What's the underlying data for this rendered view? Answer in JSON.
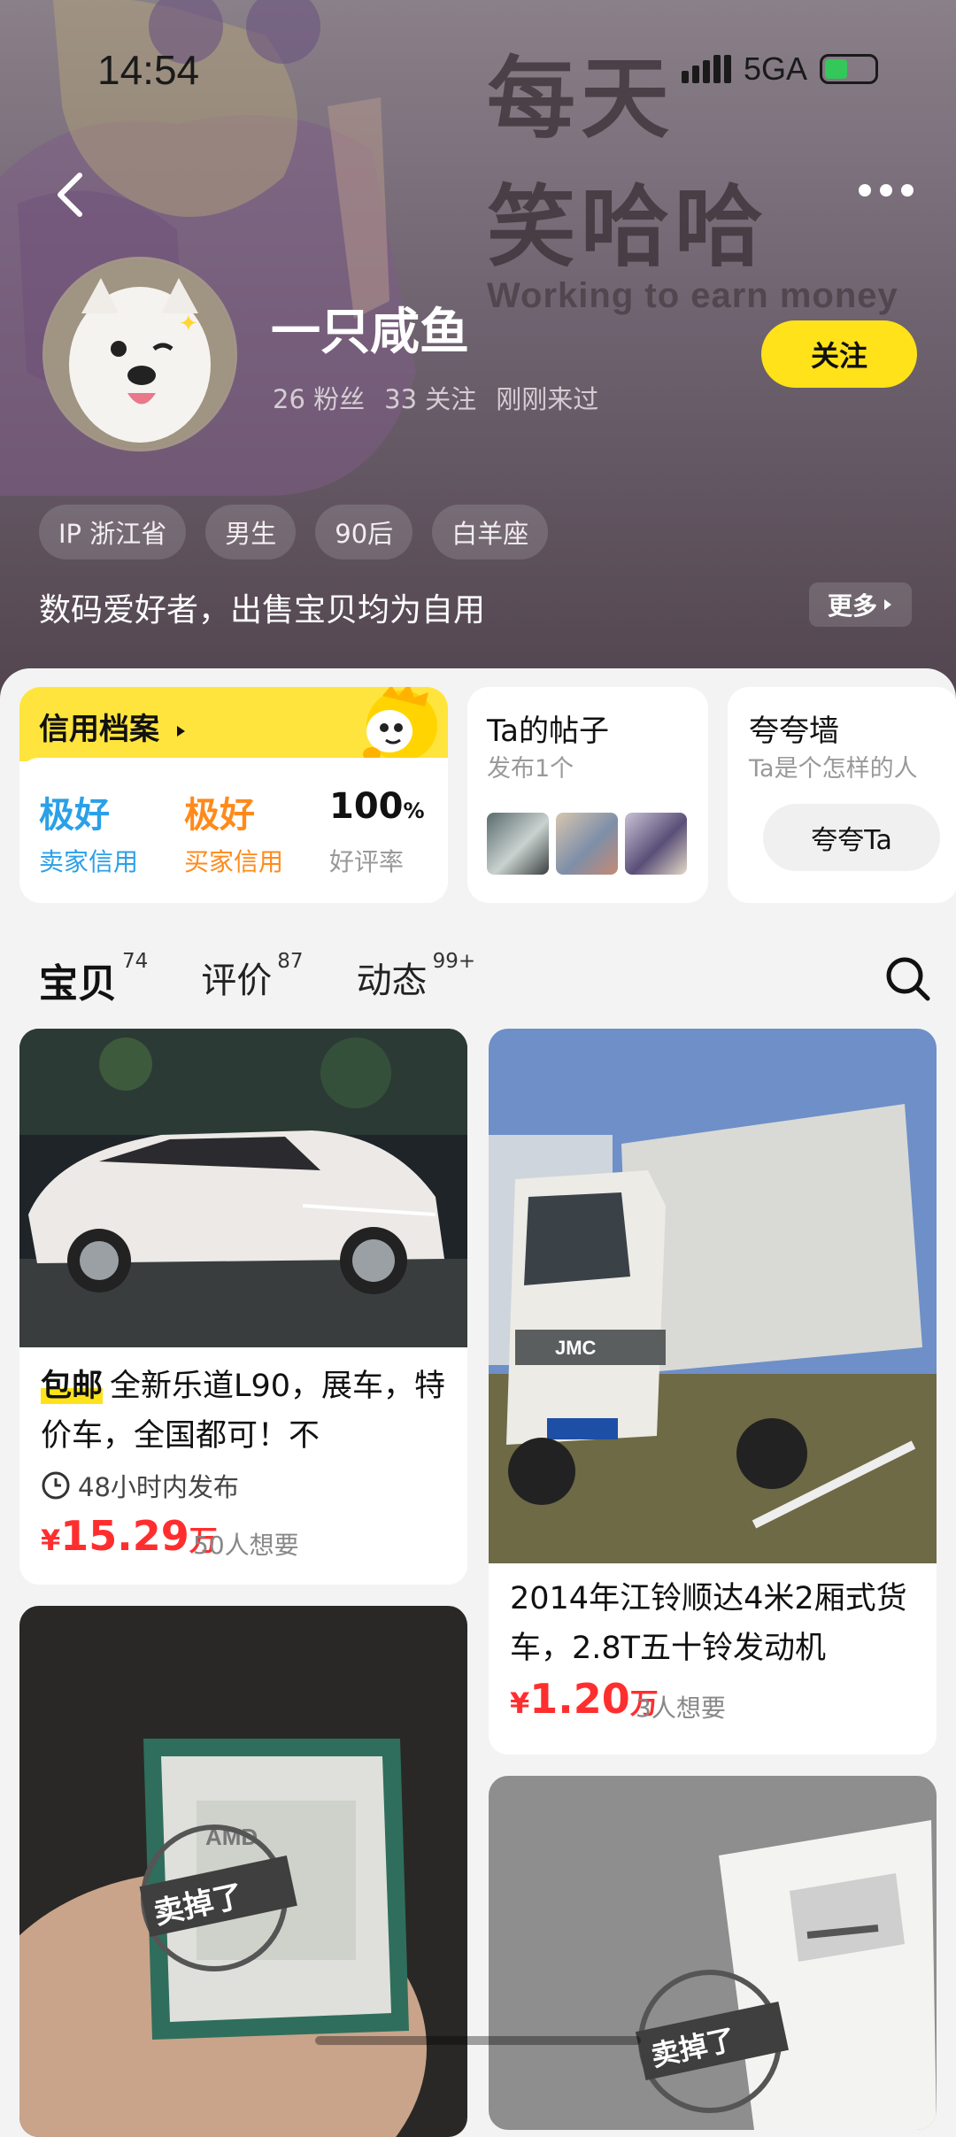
{
  "status": {
    "time": "14:54",
    "network": "5GA"
  },
  "banner": {
    "line1": "每天",
    "line2": "笑哈哈",
    "line3": "Working to earn money"
  },
  "profile": {
    "name": "一只咸鱼",
    "stats": [
      "26 粉丝",
      "33 关注",
      "刚刚来过"
    ],
    "follow_label": "关注",
    "tags": [
      "IP 浙江省",
      "男生",
      "90后",
      "白羊座"
    ],
    "bio": "数码爱好者，出售宝贝均为自用",
    "more_label": "更多"
  },
  "credit": {
    "title": "信用档案",
    "seller_value": "极好",
    "seller_label": "卖家信用",
    "buyer_value": "极好",
    "buyer_label": "买家信用",
    "rate_value": "100",
    "rate_unit": "%",
    "rate_label": "好评率"
  },
  "posts": {
    "title": "Ta的帖子",
    "subtitle": "发布1个"
  },
  "praise": {
    "title": "夸夸墙",
    "subtitle": "Ta是个怎样的人",
    "button": "夸夸Ta"
  },
  "tabs": [
    {
      "label": "宝贝",
      "count": "74"
    },
    {
      "label": "评价",
      "count": "87"
    },
    {
      "label": "动态",
      "count": "99+"
    }
  ],
  "items": [
    {
      "badge": "包邮",
      "title": "全新乐道L90，展车，特价车，全国都可！不",
      "time_note": "48小时内发布",
      "price_cur": "¥",
      "price_num": "15.29",
      "price_unit": "万",
      "want": "50人想要"
    },
    {
      "title": "2014年江铃顺达4米2厢式货车，2.8T五十铃发动机",
      "price_cur": "¥",
      "price_num": "1.20",
      "price_unit": "万",
      "want": "3人想要"
    },
    {
      "stamp": "卖掉了"
    },
    {
      "stamp": "卖掉了"
    }
  ],
  "colors": {
    "accent_yellow": "#ffe21a",
    "price_red": "#ff2e2e",
    "seller_blue": "#2aa0e8",
    "buyer_orange": "#ff8a1a"
  }
}
